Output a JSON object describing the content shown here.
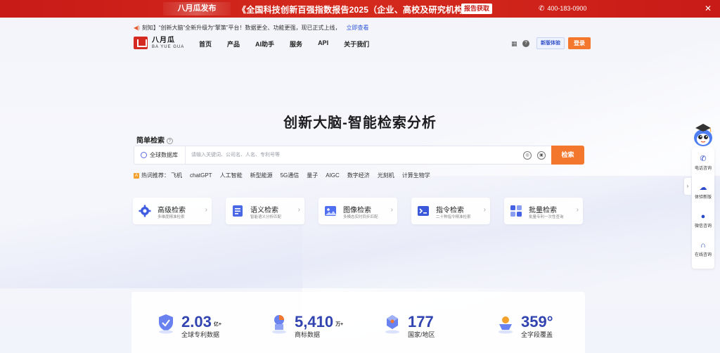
{
  "banner": {
    "tag": "八月瓜发布",
    "headline": "《全国科技创新百强指数报告2025（企业、高校及研究机构篇）》",
    "report_button": "报告获取",
    "phone": "400-183-0900"
  },
  "notice": {
    "text": "刻知】“创新大脑”全新升级为“擎策”平台！数据更全、功能更强，现已正式上线，",
    "link": "立即查看"
  },
  "logo": {
    "cn": "八月瓜",
    "en": "BA YUE GUA"
  },
  "nav": {
    "items": [
      "首页",
      "产品",
      "AI助手",
      "服务",
      "API",
      "关于我们"
    ],
    "new_version": "新版体验",
    "login": "登录"
  },
  "hero": {
    "title": "创新大脑-智能检索分析",
    "simple_label": "简单检索",
    "db_select": "全球数据库",
    "search_placeholder": "请输入关键词、公司名、人名、专利号等",
    "search_button": "检索"
  },
  "hot": {
    "label": "热词推荐：",
    "tags": [
      "飞机",
      "chatGPT",
      "人工智能",
      "新型能源",
      "5G通信",
      "量子",
      "AIGC",
      "数字经济",
      "光刻机",
      "计算生物学"
    ]
  },
  "cards": [
    {
      "title": "高级检索",
      "sub": "多维度精准检索",
      "color": "#3f5be0",
      "icon": "gear-icon"
    },
    {
      "title": "语义检索",
      "sub": "智能语义分析匹配",
      "color": "#4a67e6",
      "icon": "document-icon"
    },
    {
      "title": "图像检索",
      "sub": "多模态实时同步匹配",
      "color": "#4f6ef0",
      "icon": "image-icon"
    },
    {
      "title": "指令检索",
      "sub": "二十种指令精准检索",
      "color": "#3b58da",
      "icon": "command-icon"
    },
    {
      "title": "批量检索",
      "sub": "批量专利一次性查询",
      "color": "#4562e4",
      "icon": "grid-icon"
    }
  ],
  "stats": [
    {
      "value": "2.03",
      "unit": "亿+",
      "label": "全球专利数据"
    },
    {
      "value": "5,410",
      "unit": "万+",
      "label": "商标数据"
    },
    {
      "value": "177",
      "unit": "",
      "label": "国家/地区"
    },
    {
      "value": "359°",
      "unit": "",
      "label": "全字段覆盖"
    }
  ],
  "sidebar": {
    "items": [
      {
        "label": "电话咨询",
        "icon": "phone-icon"
      },
      {
        "label": "体验新版",
        "icon": "cloud-icon"
      },
      {
        "label": "微信咨询",
        "icon": "wechat-icon"
      },
      {
        "label": "在线咨询",
        "icon": "headset-icon"
      }
    ]
  },
  "colors": {
    "brand_red": "#c81a17",
    "accent_orange": "#f3772c",
    "primary_blue": "#3244b0"
  }
}
